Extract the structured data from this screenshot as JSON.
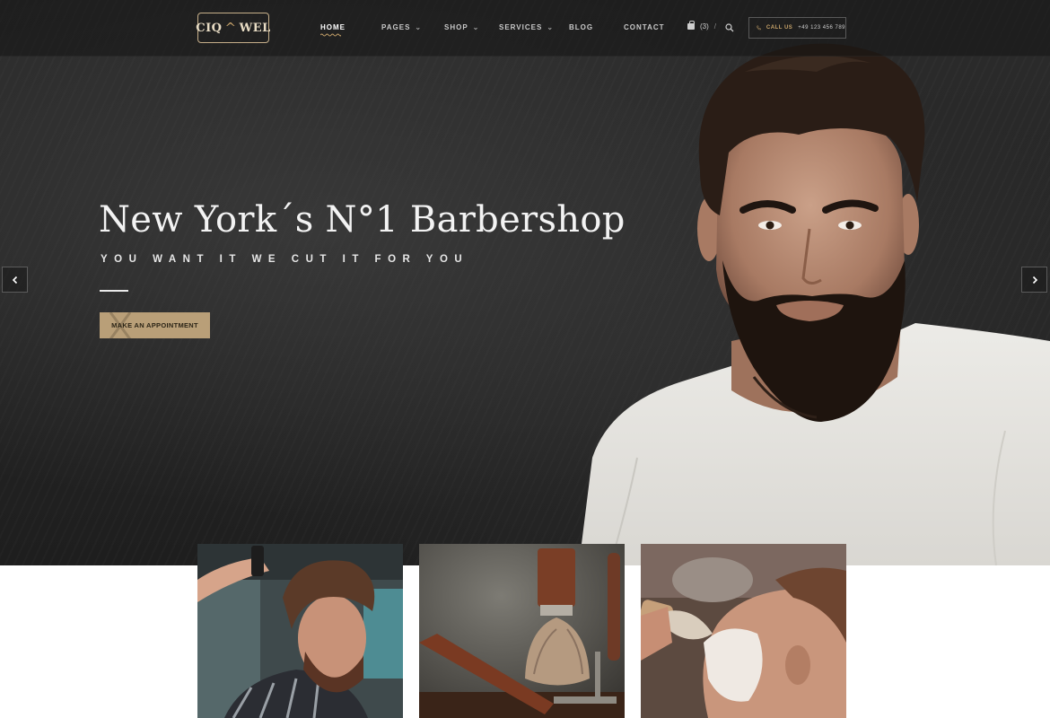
{
  "brand": {
    "logo_left": "CIQ",
    "logo_mark": "^",
    "logo_right": "WEL"
  },
  "nav": {
    "items": [
      {
        "label": "HOME",
        "active": true,
        "dropdown": false
      },
      {
        "label": "PAGES",
        "dropdown": true
      },
      {
        "label": "SHOP",
        "dropdown": true
      },
      {
        "label": "SERVICES",
        "dropdown": true
      },
      {
        "label": "BLOG",
        "dropdown": false
      },
      {
        "label": "CONTACT",
        "dropdown": false
      }
    ],
    "cart_count": "(3)",
    "separator": "/",
    "call_label": "CALL US",
    "call_number": "+49 123 456 789"
  },
  "hero": {
    "title": "New York´s N°1 Barbershop",
    "subtitle": "YOU WANT IT WE CUT IT FOR YOU",
    "cta_label": "MAKE AN APPOINTMENT"
  },
  "colors": {
    "accent": "#b99f78",
    "gold": "#c7a36a",
    "dark": "#262626"
  },
  "icons": [
    "cart-icon",
    "search-icon",
    "phone-icon",
    "chevron-left-icon",
    "chevron-right-icon"
  ]
}
